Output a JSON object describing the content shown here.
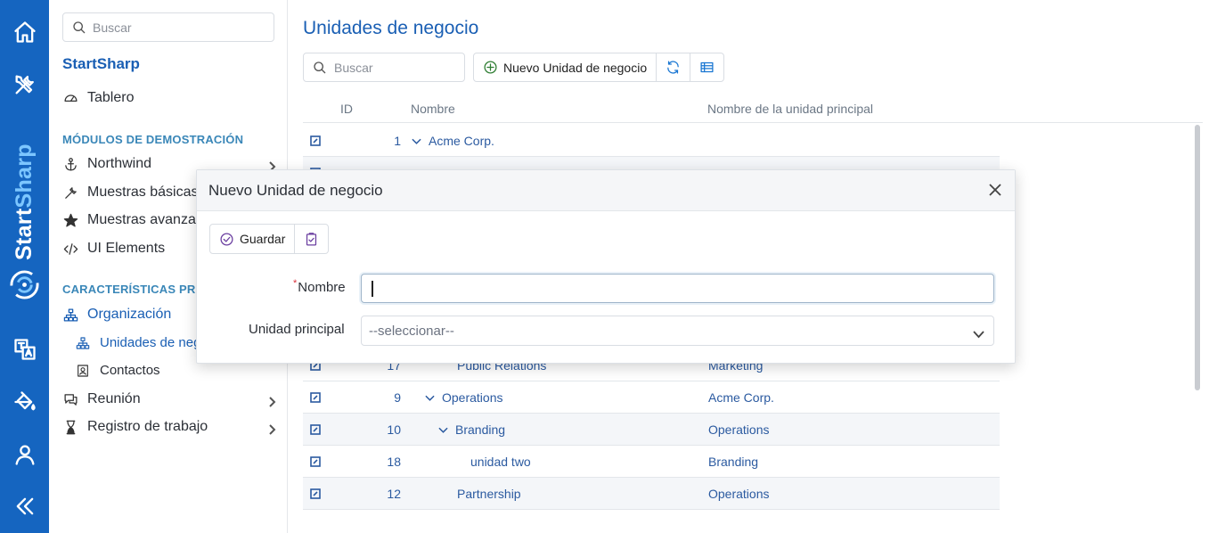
{
  "brand": {
    "part1": "Start",
    "part2": "Sharp"
  },
  "rail": {
    "icons": [
      "home-icon",
      "tools-icon",
      "translate-icon",
      "paint-bucket-icon",
      "user-icon",
      "collapse-icon"
    ]
  },
  "sidebar": {
    "search_placeholder": "Buscar",
    "app_title": "StartSharp",
    "dashboard": "Tablero",
    "section_demo": "MÓDULOS DE DEMOSTRACIÓN",
    "items_demo": [
      {
        "label": "Northwind",
        "icon": "anchor-icon"
      },
      {
        "label": "Muestras básicas",
        "icon": "wrench-icon"
      },
      {
        "label": "Muestras avanzadas",
        "icon": "star-icon"
      },
      {
        "label": "UI Elements",
        "icon": "code-icon"
      }
    ],
    "section_features": "CARACTERÍSTICAS PRO",
    "organization": "Organización",
    "sub_business_units": "Unidades de negocio",
    "sub_contacts": "Contactos",
    "meeting": "Reunión",
    "work_log": "Registro de trabajo"
  },
  "main": {
    "title": "Unidades de negocio",
    "search_placeholder": "Buscar",
    "new_button": "Nuevo Unidad de negocio",
    "columns": {
      "id": "ID",
      "name": "Nombre",
      "parent": "Nombre de la unidad principal"
    },
    "rows_top": [
      {
        "id": "1",
        "name": "Acme Corp.",
        "parent": ""
      }
    ],
    "rows_bottom": [
      {
        "id": "17",
        "name": "Public Relations",
        "parent": "Marketing"
      },
      {
        "id": "9",
        "name": "Operations",
        "parent": "Acme Corp."
      },
      {
        "id": "10",
        "name": "Branding",
        "parent": "Operations"
      },
      {
        "id": "18",
        "name": "unidad two",
        "parent": "Branding"
      },
      {
        "id": "12",
        "name": "Partnership",
        "parent": "Operations"
      }
    ]
  },
  "dialog": {
    "title": "Nuevo Unidad de negocio",
    "save_button": "Guardar",
    "name_label": "Nombre",
    "required_mark": "*",
    "name_value": "",
    "parent_label": "Unidad principal",
    "parent_placeholder": "--seleccionar--"
  },
  "colors": {
    "brand_blue": "#1565c0",
    "accent_text": "#1a5fb4",
    "link": "#2b5aa0",
    "section": "#3a87b8"
  }
}
